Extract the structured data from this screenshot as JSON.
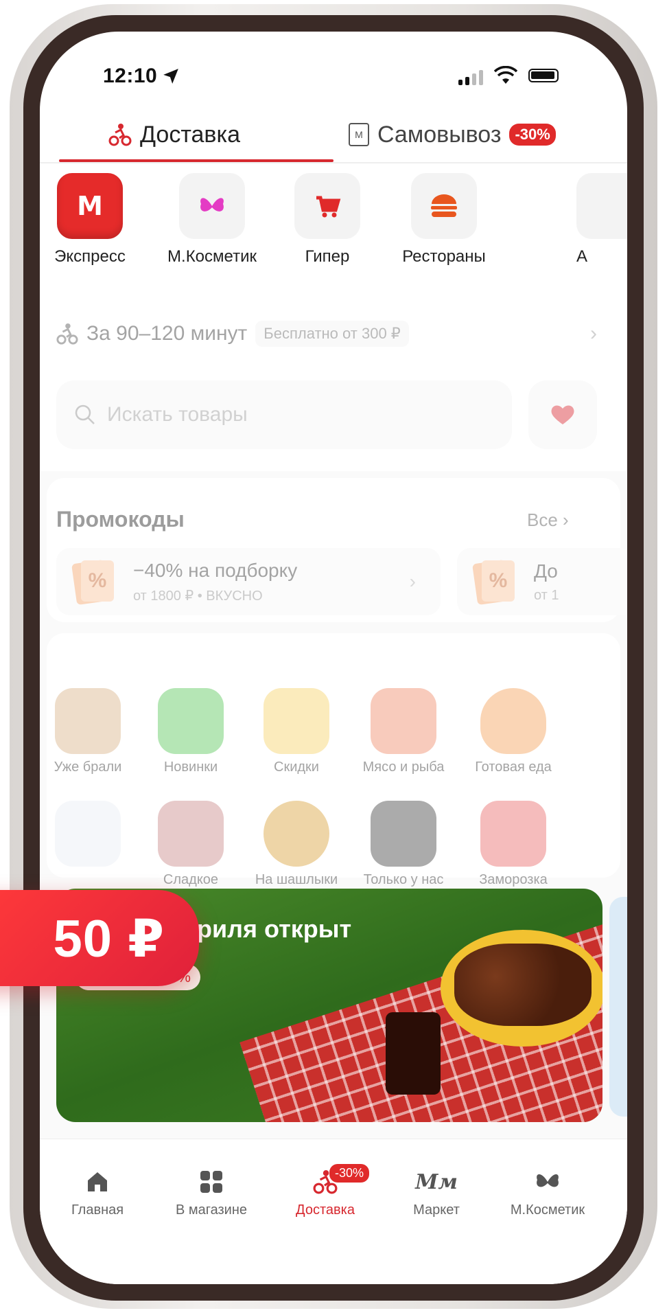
{
  "status_bar": {
    "time": "12:10"
  },
  "mode_tabs": {
    "delivery": "Доставка",
    "pickup": "Самовывоз",
    "pickup_badge": "-30%"
  },
  "stores": [
    {
      "label": "Экспресс",
      "icon": "magnit-logo-icon"
    },
    {
      "label": "М.Косметик",
      "icon": "butterfly-icon"
    },
    {
      "label": "Гипер",
      "icon": "cart-icon"
    },
    {
      "label": "Рестораны",
      "icon": "burger-icon"
    },
    {
      "label": "А",
      "icon": "store-icon"
    }
  ],
  "delivery_info": {
    "time_text": "За 90–120 минут",
    "free_text": "Бесплатно от 300 ₽"
  },
  "search": {
    "placeholder": "Искать товары"
  },
  "promocodes": {
    "title": "Промокоды",
    "all_label": "Все",
    "items": [
      {
        "title": "−40% на подборку",
        "subtitle": "от 1800 ₽ • ВКУСНО"
      },
      {
        "title": "До",
        "subtitle": "от 1"
      }
    ]
  },
  "categories": [
    {
      "label": "Уже брали"
    },
    {
      "label": "Новинки"
    },
    {
      "label": "Скидки"
    },
    {
      "label": "Мясо и рыба"
    },
    {
      "label": "Готовая еда"
    },
    {
      "label": ""
    },
    {
      "label": "Сладкое"
    },
    {
      "label": "На шашлыки"
    },
    {
      "label": "Только у нас"
    },
    {
      "label": "Заморозка"
    }
  ],
  "banner": {
    "title": "гриля открыт",
    "pill": "Скидки до 50%"
  },
  "bottom_nav": [
    {
      "label": "Главная",
      "icon": "home-icon"
    },
    {
      "label": "В магазине",
      "icon": "grid-icon"
    },
    {
      "label": "Доставка",
      "icon": "courier-icon",
      "badge": "-30%",
      "active": true
    },
    {
      "label": "Маркет",
      "icon": "market-logo-icon"
    },
    {
      "label": "М.Косметик",
      "icon": "butterfly-icon"
    }
  ],
  "price_overlay": "50 ₽",
  "colors": {
    "accent": "#d7282f",
    "badge": "#e02a2a"
  }
}
